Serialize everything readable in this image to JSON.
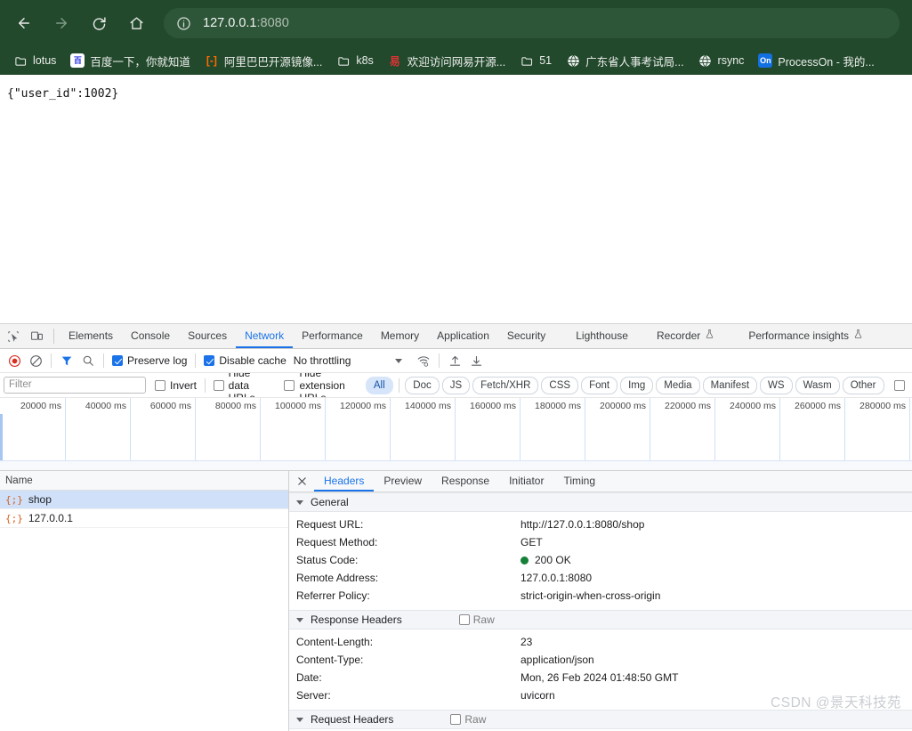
{
  "browser": {
    "nav": {
      "back_label": "Back",
      "forward_label": "Forward",
      "reload_label": "Reload",
      "home_label": "Home"
    },
    "omnibox": {
      "host": "127.0.0.1",
      "port": ":8080",
      "info_icon": "site-information-icon"
    },
    "bookmarks": [
      {
        "label": "lotus",
        "icon": "folder"
      },
      {
        "label": "百度一下，你就知道",
        "icon": "baidu",
        "color": "#2932e1"
      },
      {
        "label": "阿里巴巴开源镜像...",
        "icon": "alibaba",
        "color": "#ff6a00"
      },
      {
        "label": "k8s",
        "icon": "folder"
      },
      {
        "label": "欢迎访问网易开源...",
        "icon": "netease",
        "color": "#d33"
      },
      {
        "label": "51",
        "icon": "folder"
      },
      {
        "label": "广东省人事考试局...",
        "icon": "globe"
      },
      {
        "label": "rsync",
        "icon": "globe"
      },
      {
        "label": "ProcessOn - 我的...",
        "icon": "on",
        "color": "#1370e0",
        "badge": "On"
      }
    ]
  },
  "page": {
    "body_text": "{\"user_id\":1002}"
  },
  "devtools": {
    "inspect_icon": "inspect-element-icon",
    "device_icon": "device-toolbar-icon",
    "tabs": [
      {
        "label": "Elements",
        "active": false
      },
      {
        "label": "Console",
        "active": false
      },
      {
        "label": "Sources",
        "active": false
      },
      {
        "label": "Network",
        "active": true
      },
      {
        "label": "Performance",
        "active": false
      },
      {
        "label": "Memory",
        "active": false
      },
      {
        "label": "Application",
        "active": false
      },
      {
        "label": "Security",
        "active": false
      },
      {
        "label": "Lighthouse",
        "active": false
      },
      {
        "label": "Recorder",
        "active": false,
        "beta": true
      },
      {
        "label": "Performance insights",
        "active": false,
        "beta": true
      }
    ],
    "network_toolbar": {
      "record_label": "Record",
      "clear_label": "Clear",
      "filter_label": "Filter",
      "search_label": "Search",
      "preserve_log": {
        "label": "Preserve log",
        "checked": true
      },
      "disable_cache": {
        "label": "Disable cache",
        "checked": true
      },
      "throttling": "No throttling",
      "wifi_label": "Network conditions",
      "import_label": "Import HAR",
      "export_label": "Export HAR"
    },
    "filters": {
      "input_placeholder": "Filter",
      "input_value": "",
      "invert": {
        "label": "Invert",
        "checked": false
      },
      "hide_data_urls": {
        "label": "Hide data URLs",
        "checked": false
      },
      "hide_extension_urls": {
        "label": "Hide extension URLs",
        "checked": false
      },
      "types": [
        {
          "label": "All",
          "selected": true
        },
        {
          "label": "Doc",
          "selected": false
        },
        {
          "label": "JS",
          "selected": false
        },
        {
          "label": "Fetch/XHR",
          "selected": false
        },
        {
          "label": "CSS",
          "selected": false
        },
        {
          "label": "Font",
          "selected": false
        },
        {
          "label": "Img",
          "selected": false
        },
        {
          "label": "Media",
          "selected": false
        },
        {
          "label": "Manifest",
          "selected": false
        },
        {
          "label": "WS",
          "selected": false
        },
        {
          "label": "Wasm",
          "selected": false
        },
        {
          "label": "Other",
          "selected": false
        }
      ],
      "blocked_checkbox": {
        "label": "",
        "checked": false
      }
    },
    "overview": {
      "ticks": [
        "20000 ms",
        "40000 ms",
        "60000 ms",
        "80000 ms",
        "100000 ms",
        "120000 ms",
        "140000 ms",
        "160000 ms",
        "180000 ms",
        "200000 ms",
        "220000 ms",
        "240000 ms",
        "260000 ms",
        "280000 ms"
      ]
    },
    "request_list": {
      "column_header": "Name",
      "rows": [
        {
          "name": "shop",
          "icon": "json-icon",
          "selected": true
        },
        {
          "name": "127.0.0.1",
          "icon": "json-icon",
          "selected": false
        }
      ]
    },
    "detail": {
      "close_label": "✕",
      "tabs": [
        {
          "label": "Headers",
          "active": true
        },
        {
          "label": "Preview",
          "active": false
        },
        {
          "label": "Response",
          "active": false
        },
        {
          "label": "Initiator",
          "active": false
        },
        {
          "label": "Timing",
          "active": false
        }
      ],
      "sections": [
        {
          "title": "General",
          "expanded": true,
          "raw_toggle": null,
          "rows": [
            {
              "key": "Request URL:",
              "value": "http://127.0.0.1:8080/shop"
            },
            {
              "key": "Request Method:",
              "value": "GET"
            },
            {
              "key": "Status Code:",
              "value": "200 OK",
              "status": "green"
            },
            {
              "key": "Remote Address:",
              "value": "127.0.0.1:8080"
            },
            {
              "key": "Referrer Policy:",
              "value": "strict-origin-when-cross-origin"
            }
          ]
        },
        {
          "title": "Response Headers",
          "expanded": true,
          "raw_toggle": {
            "label": "Raw",
            "checked": false
          },
          "rows": [
            {
              "key": "Content-Length:",
              "value": "23"
            },
            {
              "key": "Content-Type:",
              "value": "application/json"
            },
            {
              "key": "Date:",
              "value": "Mon, 26 Feb 2024 01:48:50 GMT"
            },
            {
              "key": "Server:",
              "value": "uvicorn"
            }
          ]
        },
        {
          "title": "Request Headers",
          "expanded": true,
          "raw_toggle": {
            "label": "Raw",
            "checked": false
          },
          "rows": []
        }
      ]
    }
  },
  "watermark": "CSDN @景天科技苑",
  "colors": {
    "chrome_bg": "#22492c",
    "accent_blue": "#1a73e8",
    "status_green": "#178038",
    "json_orange": "#d4601f"
  }
}
